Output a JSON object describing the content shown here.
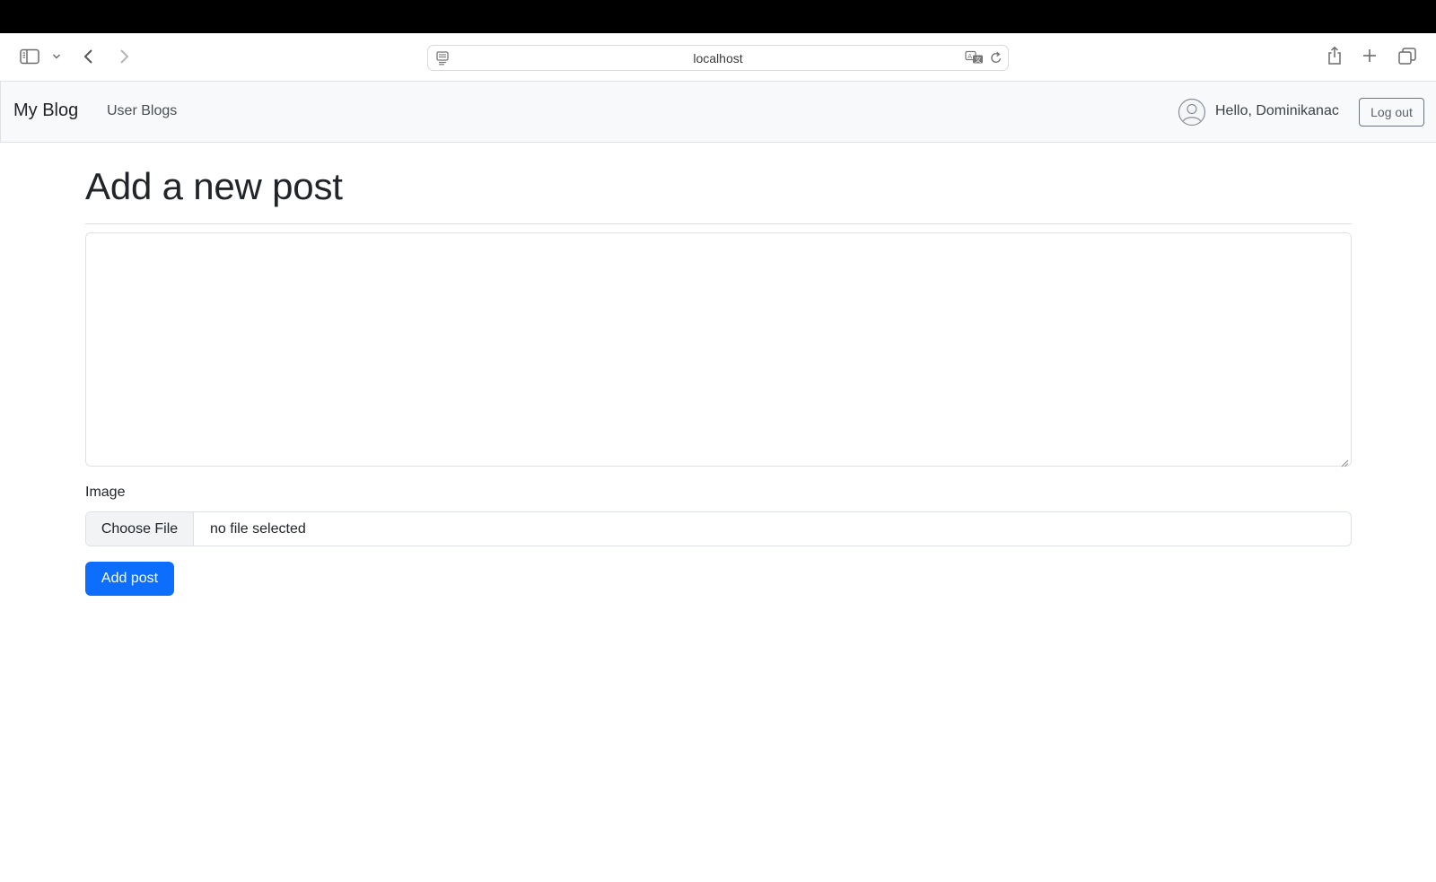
{
  "browser": {
    "url": "localhost",
    "icons": [
      "sidebar-icon",
      "chevron-down-icon",
      "back-icon",
      "forward-icon",
      "page-settings-icon",
      "translate-icon",
      "reload-icon",
      "share-icon",
      "new-tab-icon",
      "tabs-overview-icon"
    ]
  },
  "navbar": {
    "brand": "My Blog",
    "links": [
      {
        "label": "User Blogs"
      }
    ],
    "greeting": "Hello, Dominikanac",
    "logout_label": "Log out"
  },
  "form": {
    "title": "Add a new post",
    "content_value": "",
    "image_label": "Image",
    "choose_file_label": "Choose File",
    "file_status": "no file selected",
    "submit_label": "Add post"
  },
  "colors": {
    "primary": "#0d6efd",
    "navbar_bg": "#f8f9fa"
  }
}
